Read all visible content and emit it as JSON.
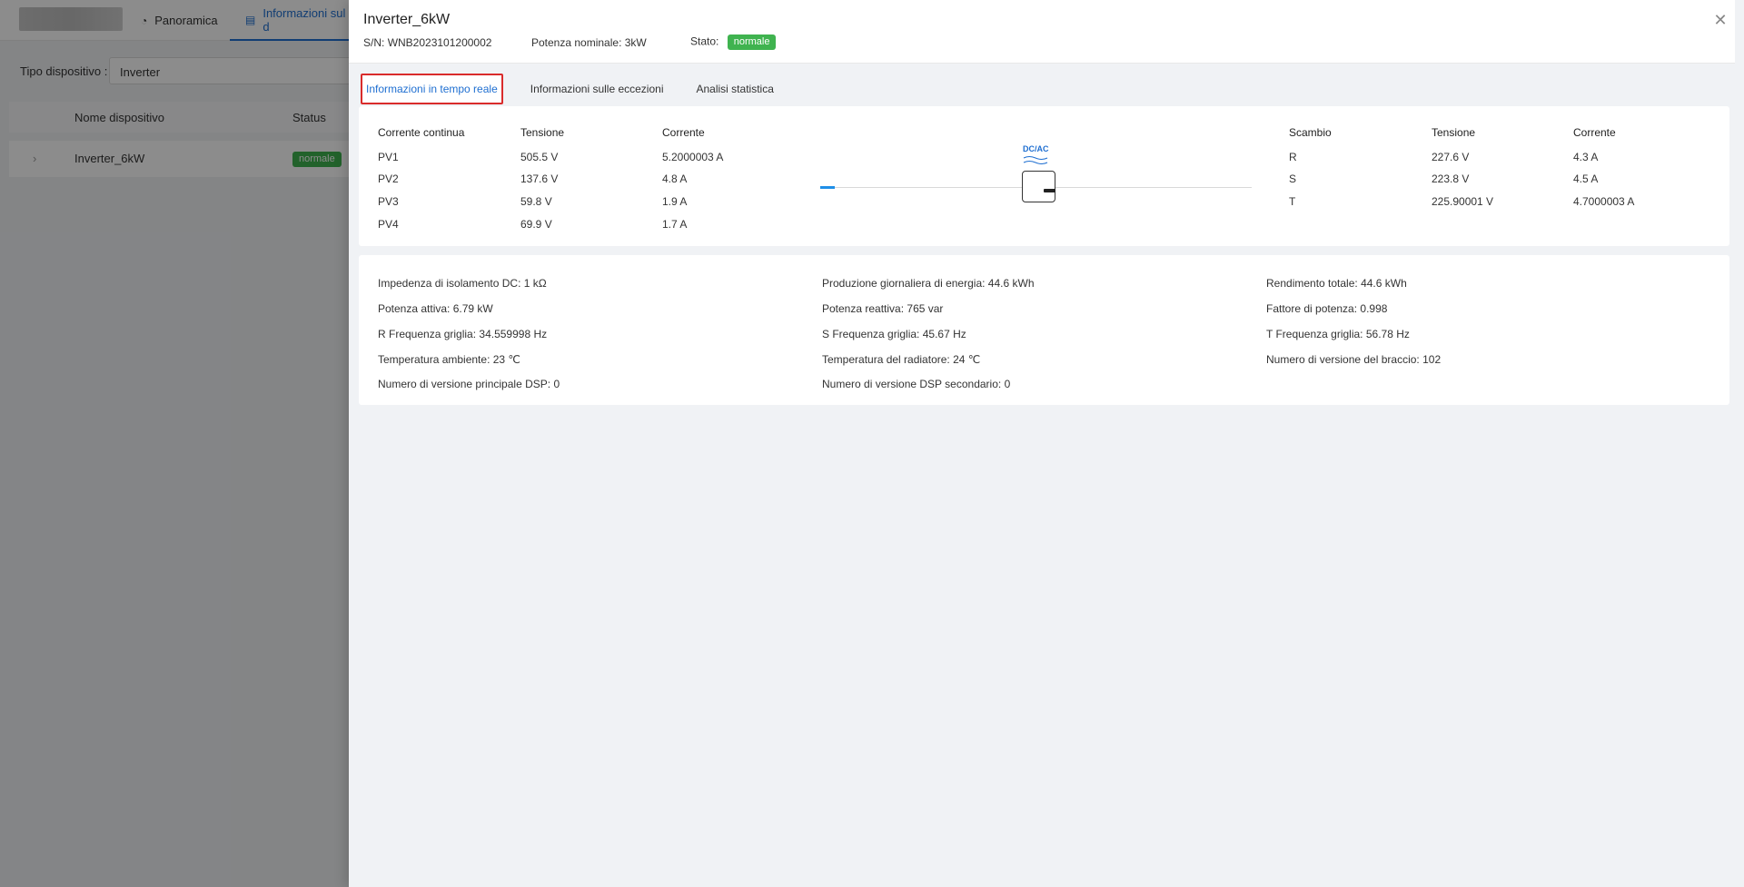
{
  "background": {
    "tabs": [
      {
        "label": "Panoramica",
        "icon": "dashboard-icon"
      },
      {
        "label": "Informazioni sul d",
        "icon": "document-icon"
      }
    ],
    "filter": {
      "label": "Tipo dispositivo :",
      "value": "Inverter"
    },
    "table": {
      "headers": [
        "Nome dispositivo",
        "Status"
      ],
      "rows": [
        {
          "name": "Inverter_6kW",
          "status": "normale"
        }
      ]
    }
  },
  "drawer": {
    "title": "Inverter_6kW",
    "sn_label": "S/N:",
    "sn": "WNB2023101200002",
    "power_label": "Potenza nominale:",
    "power": "3kW",
    "state_label": "Stato:",
    "state": "normale",
    "tabs": [
      "Informazioni in tempo reale",
      "Informazioni sulle eccezioni",
      "Analisi statistica"
    ],
    "active_tab": 0,
    "dc": {
      "headers": [
        "Corrente continua",
        "Tensione",
        "Corrente"
      ],
      "rows": [
        [
          "PV1",
          "505.5 V",
          "5.2000003 A"
        ],
        [
          "PV2",
          "137.6 V",
          "4.8 A"
        ],
        [
          "PV3",
          "59.8 V",
          "1.9 A"
        ],
        [
          "PV4",
          "69.9 V",
          "1.7 A"
        ]
      ]
    },
    "diagram_label": "DC/AC",
    "ac": {
      "headers": [
        "Scambio",
        "Tensione",
        "Corrente"
      ],
      "rows": [
        [
          "R",
          "227.6 V",
          "4.3 A"
        ],
        [
          "S",
          "223.8 V",
          "4.5 A"
        ],
        [
          "T",
          "225.90001 V",
          "4.7000003 A"
        ]
      ]
    },
    "params": [
      [
        "Impedenza di isolamento DC:",
        "1 kΩ"
      ],
      [
        "Produzione giornaliera di energia:",
        "44.6 kWh"
      ],
      [
        "Rendimento totale:",
        "44.6 kWh"
      ],
      [
        "Potenza attiva:",
        "6.79 kW"
      ],
      [
        "Potenza reattiva:",
        "765 var"
      ],
      [
        "Fattore di potenza:",
        "0.998"
      ],
      [
        "R Frequenza griglia:",
        "34.559998 Hz"
      ],
      [
        "S Frequenza griglia:",
        "45.67 Hz"
      ],
      [
        "T Frequenza griglia:",
        "56.78 Hz"
      ],
      [
        "Temperatura ambiente:",
        "23 ℃"
      ],
      [
        "Temperatura del radiatore:",
        "24 ℃"
      ],
      [
        "Numero di versione del braccio:",
        "102"
      ],
      [
        "Numero di versione principale DSP:",
        "0"
      ],
      [
        "Numero di versione DSP secondario:",
        "0"
      ]
    ]
  }
}
